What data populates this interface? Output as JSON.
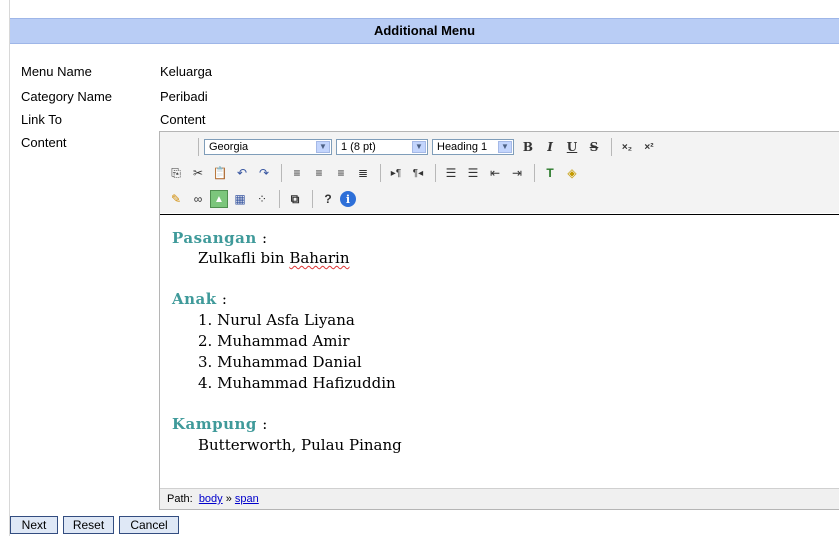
{
  "header": {
    "title": "Additional Menu"
  },
  "fields": [
    {
      "label": "Menu Name",
      "value": "Keluarga"
    },
    {
      "label": "Category Name",
      "value": "Peribadi"
    },
    {
      "label": "Link To",
      "value": "Content"
    },
    {
      "label": "Content",
      "value": ""
    }
  ],
  "toolbar": {
    "font_family": "Georgia",
    "font_size": "1 (8 pt)",
    "format": "Heading 1",
    "bold": "B",
    "italic": "I",
    "underline": "U",
    "strike": "S",
    "sub": "×₂",
    "sup": "×²",
    "help": "?"
  },
  "editor": {
    "sections": [
      {
        "heading": "Pasangan",
        "lines": [
          "Zulkafli bin Baharin"
        ]
      },
      {
        "heading": "Anak",
        "lines": [
          "1. Nurul Asfa Liyana",
          "2. Muhammad Amir",
          "3. Muhammad Danial",
          "4. Muhammad Hafizuddin"
        ]
      },
      {
        "heading": "Kampung",
        "lines": [
          "Butterworth, Pulau Pinang"
        ]
      }
    ],
    "path_label": "Path:",
    "path_body": "body",
    "path_sep": "»",
    "path_span": "span"
  },
  "buttons": {
    "next": "Next",
    "reset": "Reset",
    "cancel": "Cancel"
  },
  "colors": {
    "header_bg": "#b9cdf5",
    "heading_teal": "#3f9a9a",
    "button_border": "#334d80"
  },
  "icons": [
    "copy-icon",
    "cut-icon",
    "paste-icon",
    "undo-icon",
    "redo-icon",
    "align-left-icon",
    "align-center-icon",
    "align-right-icon",
    "justify-icon",
    "ltr-icon",
    "rtl-icon",
    "ordered-list-icon",
    "unordered-list-icon",
    "outdent-icon",
    "indent-icon",
    "text-color-icon",
    "bg-color-icon",
    "pencil-icon",
    "link-icon",
    "image-icon",
    "table-icon",
    "special-char-icon",
    "fullscreen-icon",
    "help-icon",
    "info-icon"
  ]
}
